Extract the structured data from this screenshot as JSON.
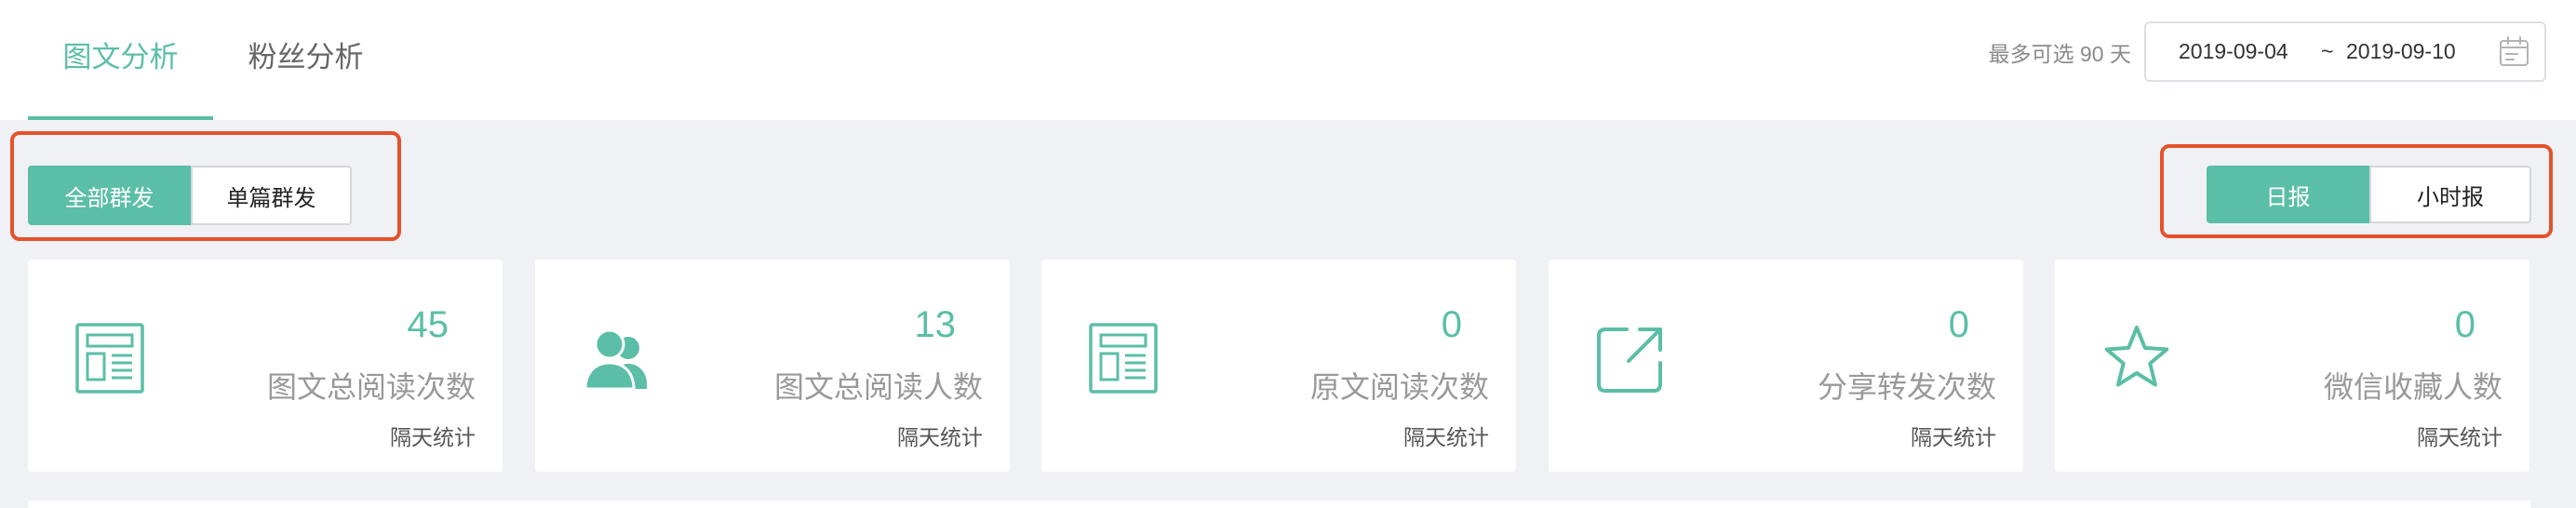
{
  "tabs": [
    {
      "label": "图文分析",
      "active": true
    },
    {
      "label": "粉丝分析",
      "active": false
    }
  ],
  "date_range": {
    "hint": "最多可选 90 天",
    "start": "2019-09-04",
    "separator": "~",
    "end": "2019-09-10",
    "icon": "calendar-icon"
  },
  "send_scope": {
    "options": [
      {
        "label": "全部群发",
        "selected": true
      },
      {
        "label": "单篇群发",
        "selected": false
      }
    ]
  },
  "report_type": {
    "options": [
      {
        "label": "日报",
        "selected": true
      },
      {
        "label": "小时报",
        "selected": false
      }
    ]
  },
  "stats": [
    {
      "icon": "article-icon",
      "value": "45",
      "label": "图文总阅读次数",
      "note": "隔天统计"
    },
    {
      "icon": "users-icon",
      "value": "13",
      "label": "图文总阅读人数",
      "note": "隔天统计"
    },
    {
      "icon": "article-icon",
      "value": "0",
      "label": "原文阅读次数",
      "note": "隔天统计"
    },
    {
      "icon": "share-icon",
      "value": "0",
      "label": "分享转发次数",
      "note": "隔天统计"
    },
    {
      "icon": "star-icon",
      "value": "0",
      "label": "微信收藏人数",
      "note": "隔天统计"
    }
  ],
  "colors": {
    "accent": "#5bbea6",
    "highlight": "#e5522b"
  }
}
